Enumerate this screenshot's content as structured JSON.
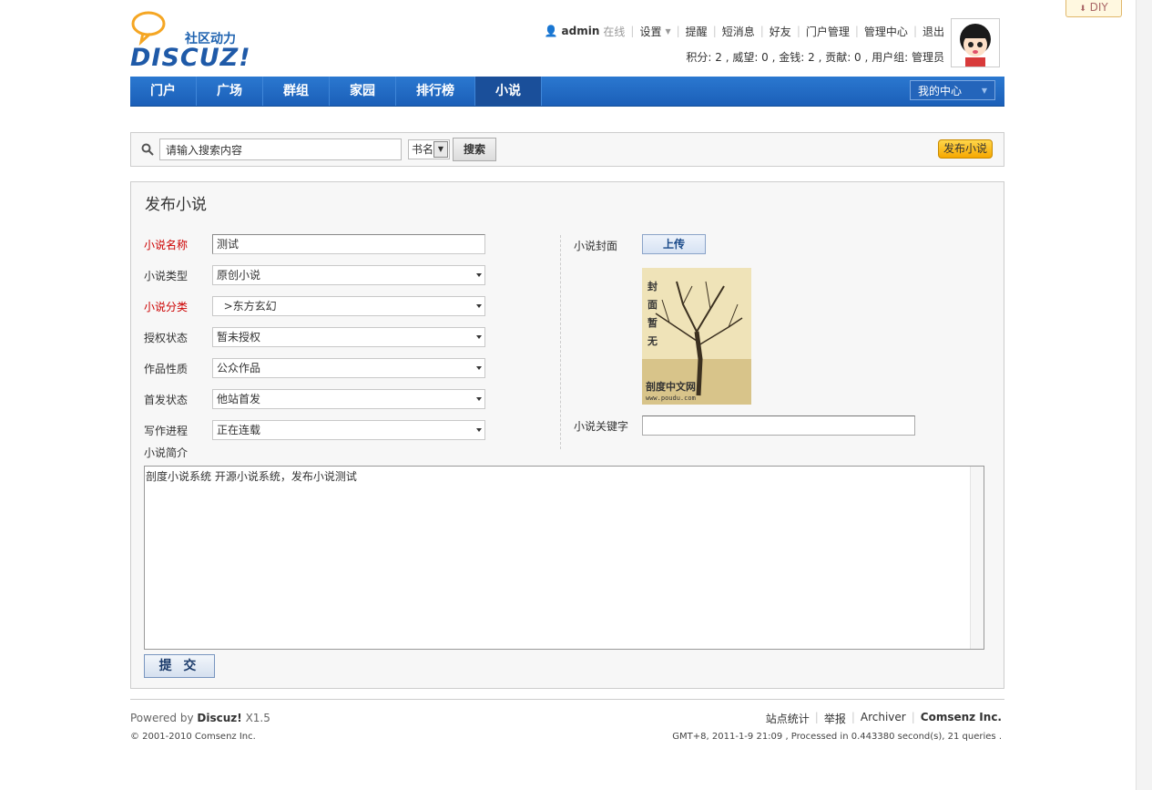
{
  "diy": {
    "label": "DIY",
    "icon": "down-arrow-icon"
  },
  "header": {
    "logo_tagline": "社区动力",
    "logo_text": "DISCUZ!",
    "username": "admin",
    "online": "在线",
    "links": [
      "设置",
      "提醒",
      "短消息",
      "好友",
      "门户管理",
      "管理中心",
      "退出"
    ],
    "stats": "积分: 2 , 威望: 0 , 金钱: 2 , 贡献: 0 , 用户组: 管理员"
  },
  "nav": {
    "items": [
      "门户",
      "广场",
      "群组",
      "家园",
      "排行榜",
      "小说"
    ],
    "active": "小说",
    "my_center": "我的中心"
  },
  "search": {
    "placeholder": "请输入搜索内容",
    "select_value": "书名",
    "button": "搜索",
    "publish": "发布小说"
  },
  "form": {
    "title": "发布小说",
    "fields": [
      {
        "label": "小说名称",
        "value": "测试"
      },
      {
        "label": "小说类型",
        "value": "原创小说"
      },
      {
        "label": "小说分类",
        "value": "  >东方玄幻"
      },
      {
        "label": "授权状态",
        "value": "暂未授权"
      },
      {
        "label": "作品性质",
        "value": "公众作品"
      },
      {
        "label": "首发状态",
        "value": "他站首发"
      },
      {
        "label": "写作进程",
        "value": "正在连载"
      }
    ],
    "cover_label": "小说封面",
    "upload": "上传",
    "cover_text": "封面暂无",
    "cover_site": "剖度中文网",
    "cover_url": "www.poudu.com",
    "keyword_label": "小说关键字",
    "keyword_value": "",
    "intro_label": "小说简介",
    "intro_value": "剖度小说系统 开源小说系统，发布小说测试",
    "submit": "提 交"
  },
  "footer": {
    "powered_prefix": "Powered by",
    "powered_brand": "Discuz!",
    "powered_version": "X1.5",
    "copyright": "© 2001-2010 Comsenz Inc.",
    "links": [
      "站点统计",
      "举报",
      "Archiver"
    ],
    "company": "Comsenz Inc.",
    "debug": "GMT+8, 2011-1-9 21:09 , Processed in 0.443380 second(s), 21 queries ."
  }
}
